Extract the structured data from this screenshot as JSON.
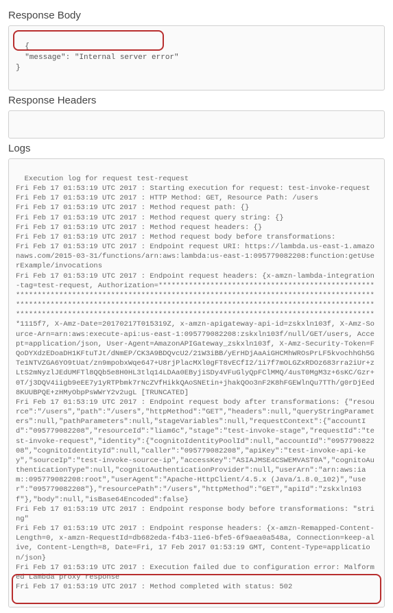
{
  "sections": {
    "response_body_title": "Response Body",
    "response_headers_title": "Response Headers",
    "logs_title": "Logs"
  },
  "response_body": "{\n  \"message\": \"Internal server error\"\n}",
  "response_headers": "",
  "logs_text": "Execution log for request test-request\nFri Feb 17 01:53:19 UTC 2017 : Starting execution for request: test-invoke-request\nFri Feb 17 01:53:19 UTC 2017 : HTTP Method: GET, Resource Path: /users\nFri Feb 17 01:53:19 UTC 2017 : Method request path: {}\nFri Feb 17 01:53:19 UTC 2017 : Method request query string: {}\nFri Feb 17 01:53:19 UTC 2017 : Method request headers: {}\nFri Feb 17 01:53:19 UTC 2017 : Method request body before transformations: \nFri Feb 17 01:53:19 UTC 2017 : Endpoint request URI: https://lambda.us-east-1.amazonaws.com/2015-03-31/functions/arn:aws:lambda:us-east-1:095779082208:function:getUserExample/invocations\nFri Feb 17 01:53:19 UTC 2017 : Endpoint request headers: {x-amzn-lambda-integration-tag=test-request, Authorization=************************************************************************************************************************************************************************************************************************************************************************************************************1115f7, X-Amz-Date=20170217T015319Z, x-amzn-apigateway-api-id=zskxln103f, X-Amz-Source-Arn=arn:aws:execute-api:us-east-1:095779082208:zskxln103f/null/GET/users, Accept=application/json, User-Agent=AmazonAPIGateway_zskxln103f, X-Amz-Security-Token=FQoDYXdzEDoaDH1KFtuTJt/dNmEP/CK3A9BDQvcU2/21W3iBB/yErHDjAaAiGHCMhWROsPrLF5kvochhGh5GTe1NTVZGA6YO9tUat/zn9mpobxWqe647+U8rjPlacMXl0gFT8vECfI2/1i7f7mOLGZxRDOz683rra2iUr+zLtS2mNyzlJEdUMFTl8QQb5e8H0HL3tlq14LDAa0EByjiSDy4VFuGlyQpFClMMQ/4usT0MgM3z+6sKC/Gzr+0T/j3DQV4iigb9eEE7y1yRTPbmk7rNcZVfHikkQAoSNEtin+jhakQOo3nF2K8hFGEWlnQu7TTh/g0rDjEed8KUUBPQE+zHMyObpPsWWrY2v2ugL [TRUNCATED]\nFri Feb 17 01:53:19 UTC 2017 : Endpoint request body after transformations: {\"resource\":\"/users\",\"path\":\"/users\",\"httpMethod\":\"GET\",\"headers\":null,\"queryStringParameters\":null,\"pathParameters\":null,\"stageVariables\":null,\"requestContext\":{\"accountId\":\"095779082208\",\"resourceId\":\"liam6c\",\"stage\":\"test-invoke-stage\",\"requestId\":\"test-invoke-request\",\"identity\":{\"cognitoIdentityPoolId\":null,\"accountId\":\"095779082208\",\"cognitoIdentityId\":null,\"caller\":\"095779082208\",\"apiKey\":\"test-invoke-api-key\",\"sourceIp\":\"test-invoke-source-ip\",\"accessKey\":\"ASIAJMSE4CSWEMVAST0A\",\"cognitoAuthenticationType\":null,\"cognitoAuthenticationProvider\":null,\"userArn\":\"arn:aws:iam::095779082208:root\",\"userAgent\":\"Apache-HttpClient/4.5.x (Java/1.8.0_102)\",\"user\":\"095779082208\"},\"resourcePath\":\"/users\",\"httpMethod\":\"GET\",\"apiId\":\"zskxln103f\"},\"body\":null,\"isBase64Encoded\":false}\nFri Feb 17 01:53:19 UTC 2017 : Endpoint response body before transformations: \"string\"\nFri Feb 17 01:53:19 UTC 2017 : Endpoint response headers: {x-amzn-Remapped-Content-Length=0, x-amzn-RequestId=db682eda-f4b3-11e6-bfe5-6f9aea0a548a, Connection=keep-alive, Content-Length=8, Date=Fri, 17 Feb 2017 01:53:19 GMT, Content-Type=application/json}\nFri Feb 17 01:53:19 UTC 2017 : Execution failed due to configuration error: Malformed Lambda proxy response\nFri Feb 17 01:53:19 UTC 2017 : Method completed with status: 502"
}
